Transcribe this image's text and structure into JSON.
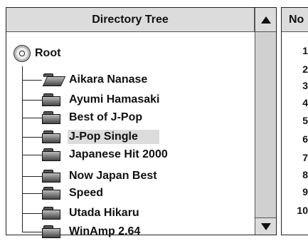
{
  "left_panel": {
    "header": "Directory Tree",
    "root_label": "Root",
    "folders": [
      {
        "label": "Aikara Nanase",
        "open": true
      },
      {
        "label": "Ayumi Hamasaki"
      },
      {
        "label": "Best of J-Pop"
      },
      {
        "label": "J-Pop Single",
        "selected": true
      },
      {
        "label": "Japanese Hit 2000"
      },
      {
        "label": "Now Japan Best"
      },
      {
        "label": "Speed"
      },
      {
        "label": "Utada Hikaru"
      },
      {
        "label": "WinAmp 2.64"
      }
    ]
  },
  "right_panel": {
    "header": "No",
    "numbers": [
      "1",
      "2",
      "3",
      "4",
      "5",
      "6",
      "7",
      "8",
      "9",
      "10"
    ]
  },
  "icons": {
    "root": "cd-disc-icon",
    "folder": "folder-icon",
    "scroll_up": "triangle-up-icon",
    "scroll_down": "triangle-down-icon"
  }
}
